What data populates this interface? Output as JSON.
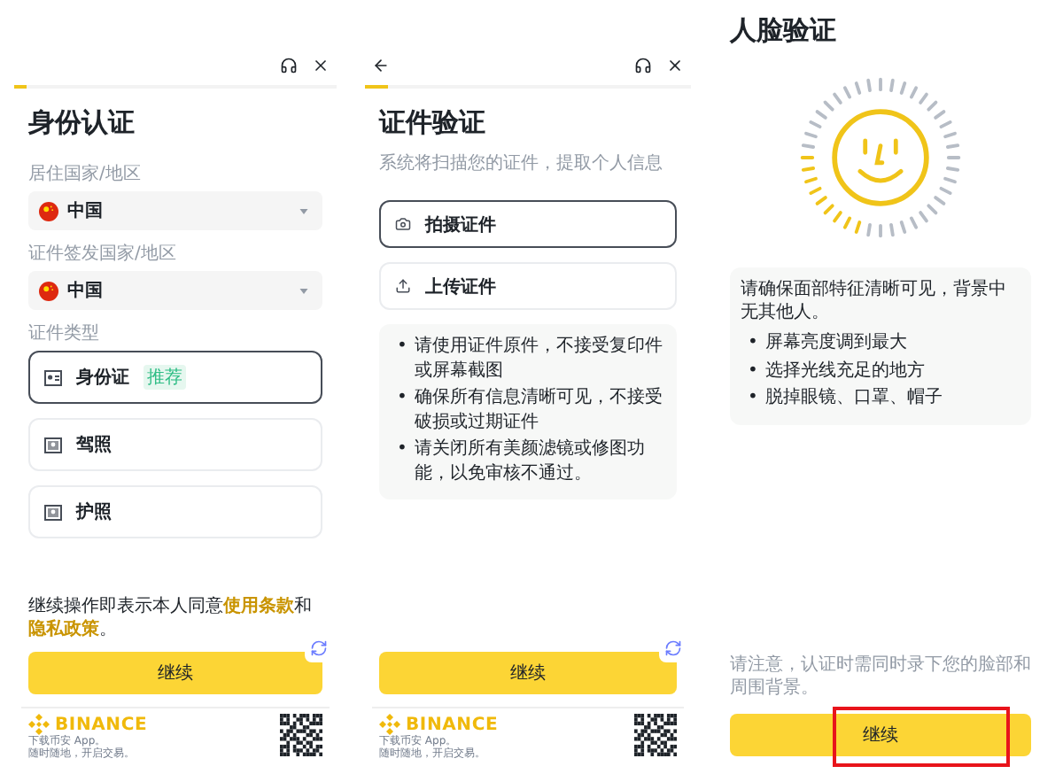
{
  "identity": {
    "progress": {
      "level": 0.04
    },
    "title": "身份认证",
    "fields": [
      {
        "label": "居住国家/地区",
        "value": "中国"
      },
      {
        "label": "证件签发国家/地区",
        "value": "中国"
      }
    ],
    "doc_type_label": "证件类型",
    "doc_types": [
      {
        "label": "身份证",
        "badge": "推荐",
        "selected": true
      },
      {
        "label": "驾照",
        "selected": false
      },
      {
        "label": "护照",
        "selected": false
      }
    ],
    "agreement": {
      "text": "继续操作即表示本人同意",
      "terms_link": "使用条款",
      "joiner": "和",
      "privacy_link": "隐私政策",
      "end": "。"
    },
    "button": "继续",
    "footer": {
      "brand": "BINANCE",
      "lines": [
        "下载币安 App。",
        "随时随地，开启交易。"
      ]
    }
  },
  "document": {
    "progress": {
      "level": 0.07
    },
    "title": "证件验证",
    "subtitle": "系统将扫描您的证件，提取个人信息",
    "options": [
      {
        "kind": "camera",
        "label": "拍摄证件",
        "selected": true
      },
      {
        "kind": "upload",
        "label": "上传证件",
        "selected": false
      }
    ],
    "tips": [
      {
        "bullet": "•",
        "text": "请使用证件原件，不接受复印件或屏幕截图"
      },
      {
        "bullet": "•",
        "text": "确保所有信息清晰可见，不接受破损或过期证件"
      },
      {
        "bullet": "•",
        "text": "请关闭所有美颜滤镜或修图功能，以免审核不通过。"
      }
    ],
    "button": "继续",
    "footer": {
      "brand": "BINANCE",
      "lines": [
        "下载币安 App。",
        "随时随地，开启交易。"
      ]
    }
  },
  "face": {
    "title": "人脸验证",
    "intro": "请确保面部特征清晰可见，背景中无其他人。",
    "tips": [
      {
        "bullet": "•",
        "text": "屏幕亮度调到最大"
      },
      {
        "bullet": "•",
        "text": "选择光线充足的地方"
      },
      {
        "bullet": "•",
        "text": "脱掉眼镜、口罩、帽子"
      }
    ],
    "note": "请注意，认证时需同时录下您的脸部和周围背景。",
    "button": "继续",
    "highlighted": true
  }
}
